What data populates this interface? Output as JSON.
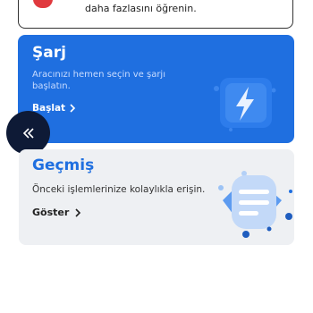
{
  "top_card": {
    "text": "daha fazlasını öğrenin."
  },
  "charge_card": {
    "title": "Şarj",
    "description": "Aracınızı hemen seçin ve şarjı başlatın.",
    "action_label": "Başlat",
    "accent": "#1f6fe0"
  },
  "back_button": {
    "icon": "double-chevron-left-icon"
  },
  "history_card": {
    "title": "Geçmiş",
    "description": "Önceki işlemlerinize kolaylıkla erişin.",
    "action_label": "Göster",
    "background": "#eef0f3"
  }
}
